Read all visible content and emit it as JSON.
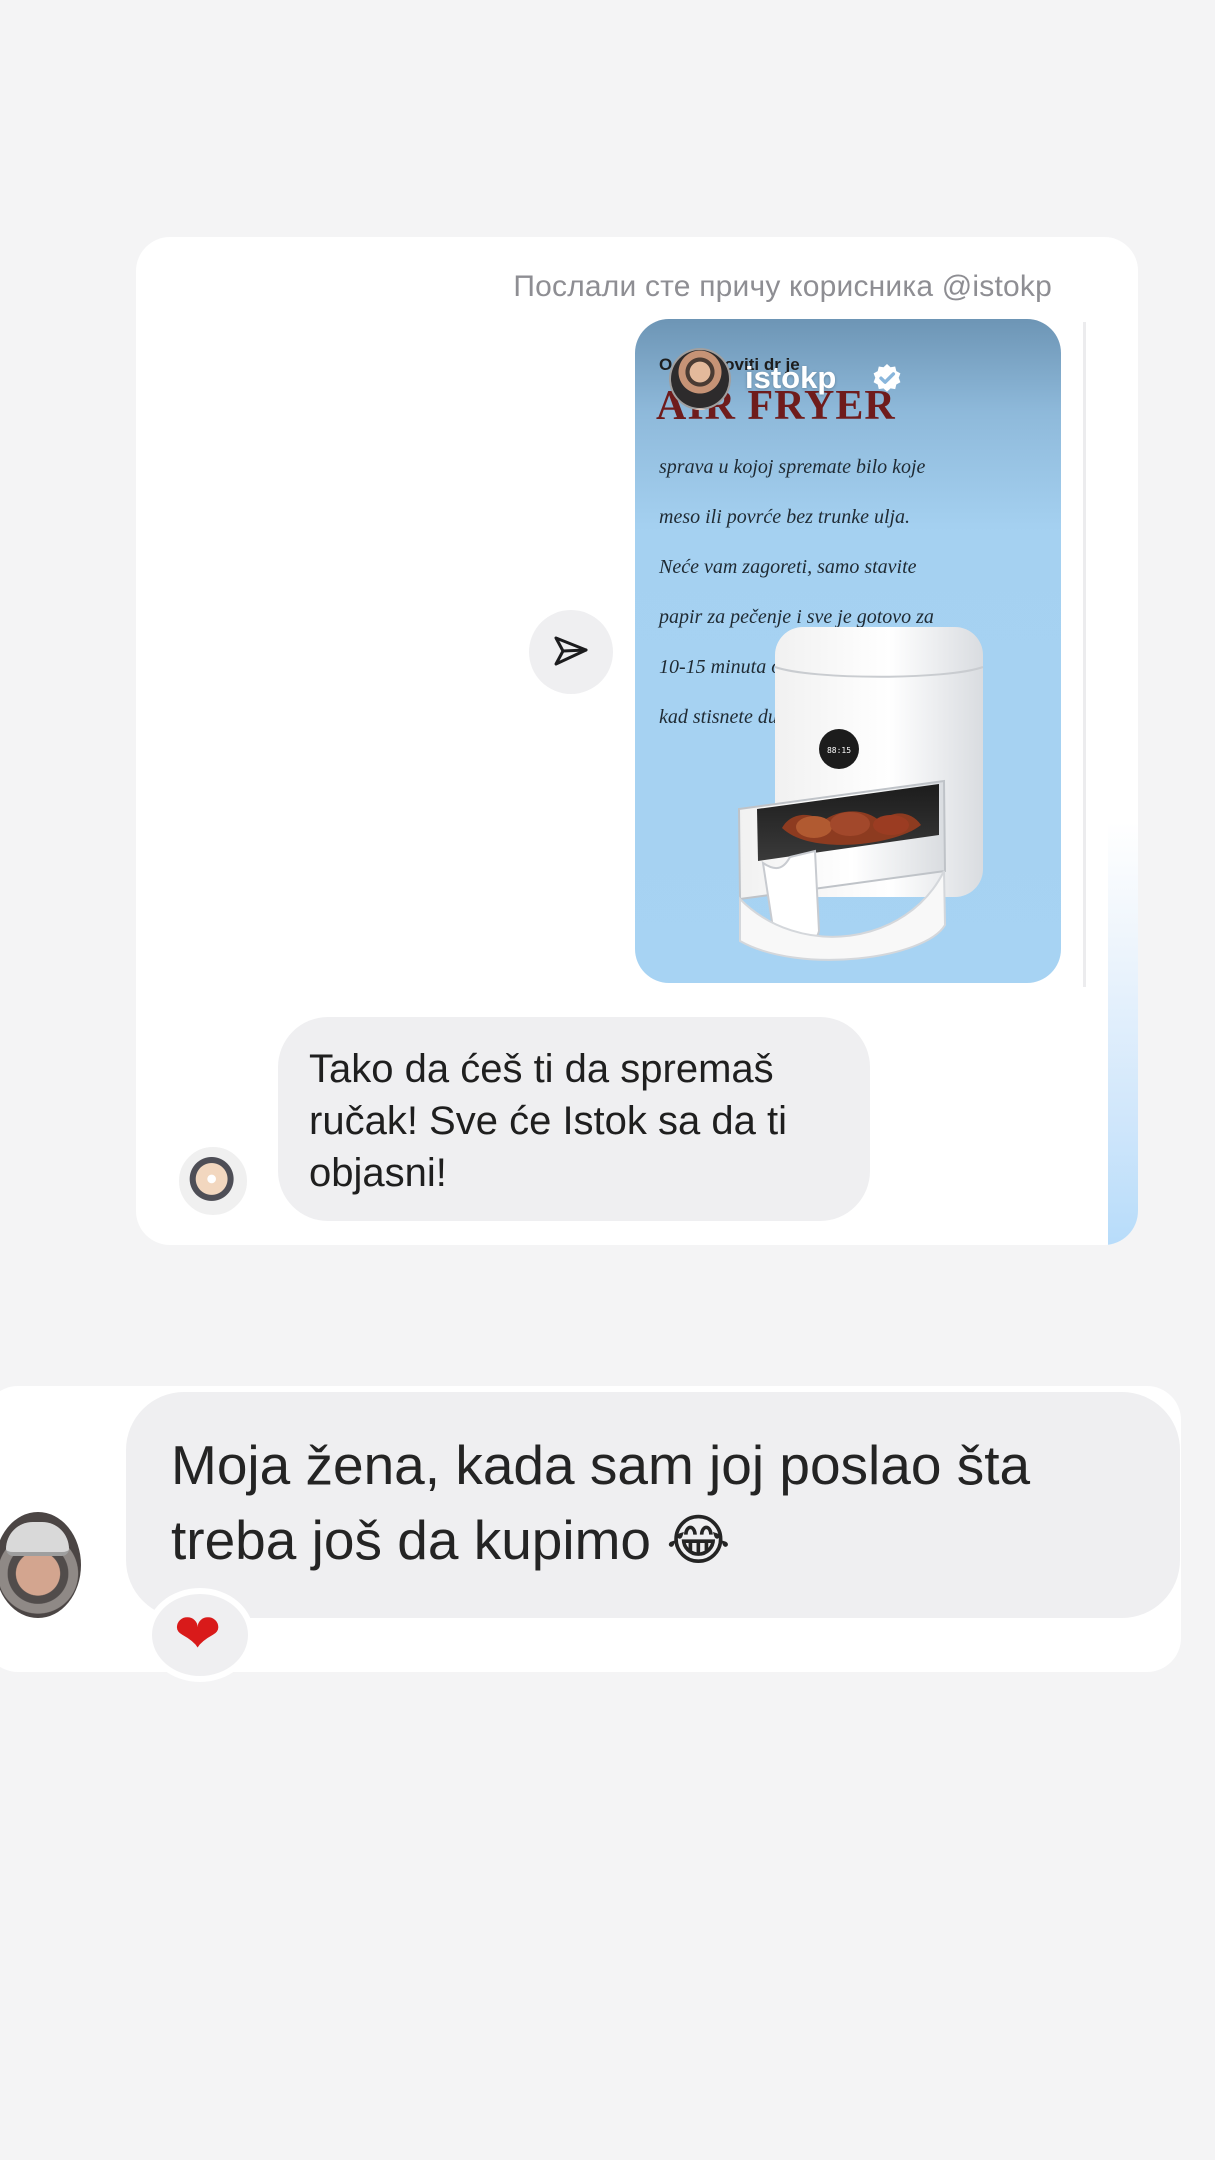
{
  "chat": {
    "story_share": {
      "caption": "Послали сте причу корисника @istokp",
      "story": {
        "username": "istokp",
        "verified": true,
        "small_heading": "O… povoviti dr je",
        "headline": "AIR FRYER",
        "body_lines": [
          "sprava u kojoj spremate bilo koje",
          "meso ili povrće bez trunke ulja.",
          "Neće vam zagoreti, samo stavite",
          "papir za pečenje i sve je gotovo za",
          "10-15 minuta od momenta",
          "kad stisnete dugme."
        ],
        "device_display": "88:15"
      },
      "share_icon": "send-icon"
    },
    "incoming_message": {
      "text": "Tako da ćeš ti da spremaš ručak! Sve će Istok sa da ti objasni!"
    },
    "overlay_message": {
      "text": "Moja žena, kada sam joj poslao šta treba još da kupimo",
      "emoji": "😂",
      "reaction": "❤"
    }
  }
}
